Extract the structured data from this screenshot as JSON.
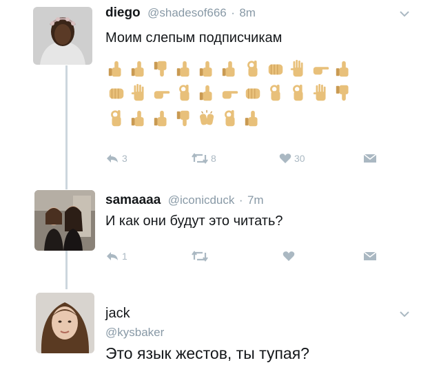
{
  "tweets": [
    {
      "display_name": "diego",
      "handle": "@shadesof666",
      "time": "8m",
      "text": "Моим слепым подписчикам",
      "emoji_rows": [
        [
          "thumbs-up",
          "thumbs-up",
          "thumbs-down",
          "thumbs-up",
          "thumbs-up",
          "thumbs-up",
          "ok-hand",
          "fist",
          "raised-hand",
          "pointing-hand",
          "thumbs-up"
        ],
        [
          "fist",
          "raised-hand",
          "pointing-hand",
          "ok-hand",
          "thumbs-up",
          "pointing-hand",
          "fist",
          "ok-hand",
          "ok-hand",
          "raised-hand",
          "thumbs-down"
        ],
        [
          "ok-hand",
          "thumbs-up",
          "thumbs-up",
          "thumbs-down",
          "clapping-hands",
          "ok-hand",
          "thumbs-up"
        ]
      ],
      "actions": {
        "replies": "3",
        "retweets": "8",
        "likes": "30"
      }
    },
    {
      "display_name": "samaaaa",
      "handle": "@iconicduck",
      "time": "7m",
      "text": "И как они будут это читать?",
      "actions": {
        "replies": "1",
        "retweets": "",
        "likes": ""
      }
    },
    {
      "display_name": "jack",
      "handle": "@kysbaker",
      "text": "Это язык жестов, ты тупая?"
    }
  ],
  "colors": {
    "text": "#14171a",
    "muted": "#8899a6",
    "action": "#aab8c2",
    "thread": "#ccd6dd",
    "skin": "#e8c07a"
  }
}
